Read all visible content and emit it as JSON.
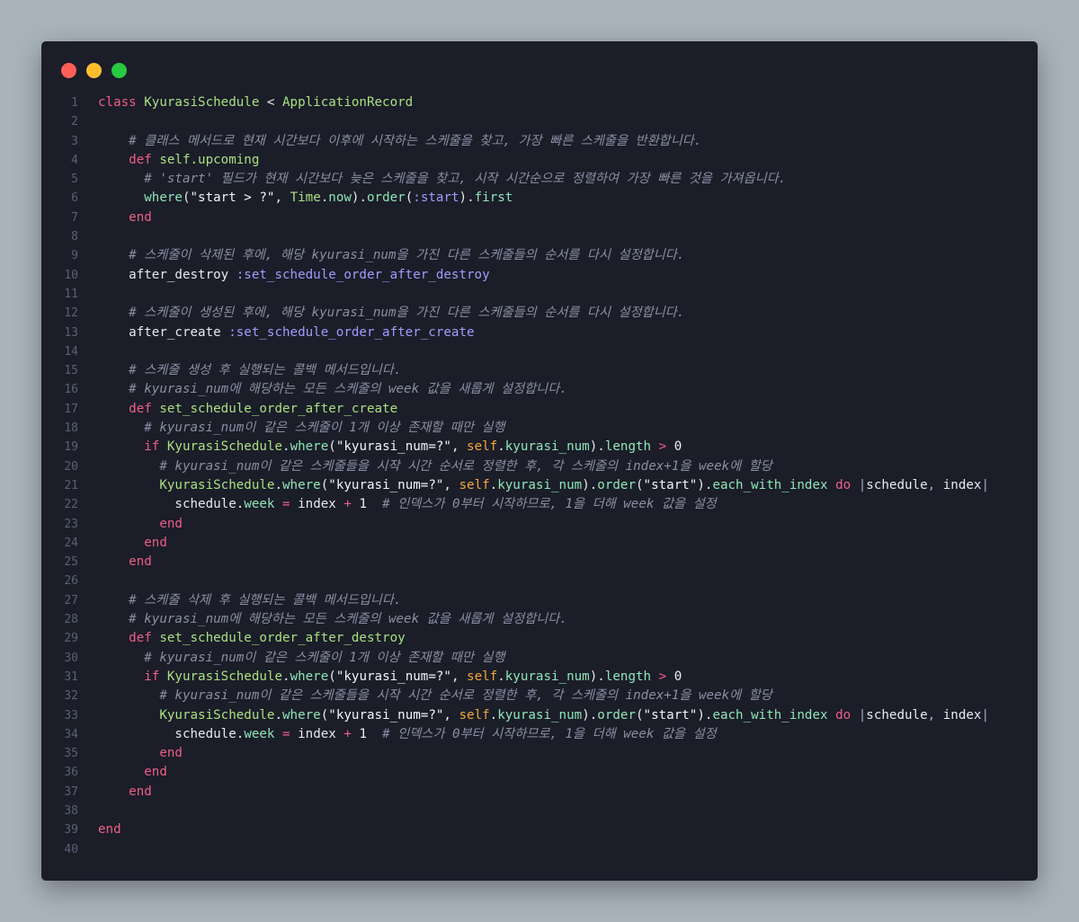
{
  "window": {
    "controls": [
      {
        "name": "close-button",
        "color": "#ff5f56"
      },
      {
        "name": "minimize-button",
        "color": "#ffbd2e"
      },
      {
        "name": "maximize-button",
        "color": "#27c93f"
      }
    ]
  },
  "code": {
    "lines": [
      {
        "n": "1",
        "tokens": [
          [
            "class",
            "kw"
          ],
          [
            " ",
            "pl"
          ],
          [
            "KyurasiSchedule",
            "cls"
          ],
          [
            " < ",
            "pl"
          ],
          [
            "ApplicationRecord",
            "cls"
          ]
        ]
      },
      {
        "n": "2",
        "tokens": []
      },
      {
        "n": "3",
        "tokens": [
          [
            "    ",
            "pl"
          ],
          [
            "# 클래스 메서드로 현재 시간보다 이후에 시작하는 스케줄을 찾고, 가장 빠른 스케줄을 반환합니다.",
            "cm"
          ]
        ]
      },
      {
        "n": "4",
        "tokens": [
          [
            "    ",
            "pl"
          ],
          [
            "def",
            "kw"
          ],
          [
            " ",
            "pl"
          ],
          [
            "self.upcoming",
            "def"
          ]
        ]
      },
      {
        "n": "5",
        "tokens": [
          [
            "      ",
            "pl"
          ],
          [
            "# 'start' 필드가 현재 시간보다 늦은 스케줄을 찾고, 시작 시간순으로 정렬하여 가장 빠른 것을 가져옵니다.",
            "cm"
          ]
        ]
      },
      {
        "n": "6",
        "tokens": [
          [
            "      ",
            "pl"
          ],
          [
            "where",
            "fn"
          ],
          [
            "(",
            "pl"
          ],
          [
            "\"start > ?\"",
            "str"
          ],
          [
            ", ",
            "pl"
          ],
          [
            "Time",
            "cls"
          ],
          [
            ".",
            "pl"
          ],
          [
            "now",
            "fn"
          ],
          [
            ").",
            "pl"
          ],
          [
            "order",
            "fn"
          ],
          [
            "(",
            "pl"
          ],
          [
            ":start",
            "sym"
          ],
          [
            ").",
            "pl"
          ],
          [
            "first",
            "fn"
          ]
        ]
      },
      {
        "n": "7",
        "tokens": [
          [
            "    ",
            "pl"
          ],
          [
            "end",
            "kw"
          ]
        ]
      },
      {
        "n": "8",
        "tokens": []
      },
      {
        "n": "9",
        "tokens": [
          [
            "    ",
            "pl"
          ],
          [
            "# 스케줄이 삭제된 후에, 해당 kyurasi_num을 가진 다른 스케줄들의 순서를 다시 설정합니다.",
            "cm"
          ]
        ]
      },
      {
        "n": "10",
        "tokens": [
          [
            "    ",
            "pl"
          ],
          [
            "after_destroy",
            "pl"
          ],
          [
            " ",
            "pl"
          ],
          [
            ":set_schedule_order_after_destroy",
            "sym"
          ]
        ]
      },
      {
        "n": "11",
        "tokens": []
      },
      {
        "n": "12",
        "tokens": [
          [
            "    ",
            "pl"
          ],
          [
            "# 스케줄이 생성된 후에, 해당 kyurasi_num을 가진 다른 스케줄들의 순서를 다시 설정합니다.",
            "cm"
          ]
        ]
      },
      {
        "n": "13",
        "tokens": [
          [
            "    ",
            "pl"
          ],
          [
            "after_create",
            "pl"
          ],
          [
            " ",
            "pl"
          ],
          [
            ":set_schedule_order_after_create",
            "sym"
          ]
        ]
      },
      {
        "n": "14",
        "tokens": []
      },
      {
        "n": "15",
        "tokens": [
          [
            "    ",
            "pl"
          ],
          [
            "# 스케줄 생성 후 실행되는 콜백 메서드입니다.",
            "cm"
          ]
        ]
      },
      {
        "n": "16",
        "tokens": [
          [
            "    ",
            "pl"
          ],
          [
            "# kyurasi_num에 해당하는 모든 스케줄의 week 값을 새롭게 설정합니다.",
            "cm"
          ]
        ]
      },
      {
        "n": "17",
        "tokens": [
          [
            "    ",
            "pl"
          ],
          [
            "def",
            "kw"
          ],
          [
            " ",
            "pl"
          ],
          [
            "set_schedule_order_after_create",
            "def"
          ]
        ]
      },
      {
        "n": "18",
        "tokens": [
          [
            "      ",
            "pl"
          ],
          [
            "# kyurasi_num이 같은 스케줄이 1개 이상 존재할 때만 실행",
            "cm"
          ]
        ]
      },
      {
        "n": "19",
        "tokens": [
          [
            "      ",
            "pl"
          ],
          [
            "if",
            "kw"
          ],
          [
            " ",
            "pl"
          ],
          [
            "KyurasiSchedule",
            "cls"
          ],
          [
            ".",
            "pl"
          ],
          [
            "where",
            "fn"
          ],
          [
            "(",
            "pl"
          ],
          [
            "\"kyurasi_num=?\"",
            "str"
          ],
          [
            ", ",
            "pl"
          ],
          [
            "self",
            "self"
          ],
          [
            ".",
            "pl"
          ],
          [
            "kyurasi_num",
            "fn"
          ],
          [
            ").",
            "pl"
          ],
          [
            "length",
            "fn"
          ],
          [
            " ",
            "pl"
          ],
          [
            ">",
            "op"
          ],
          [
            " ",
            "pl"
          ],
          [
            "0",
            "num"
          ]
        ]
      },
      {
        "n": "20",
        "tokens": [
          [
            "        ",
            "pl"
          ],
          [
            "# kyurasi_num이 같은 스케줄들을 시작 시간 순서로 정렬한 후, 각 스케줄의 index+1을 week에 할당",
            "cm"
          ]
        ]
      },
      {
        "n": "21",
        "tokens": [
          [
            "        ",
            "pl"
          ],
          [
            "KyurasiSchedule",
            "cls"
          ],
          [
            ".",
            "pl"
          ],
          [
            "where",
            "fn"
          ],
          [
            "(",
            "pl"
          ],
          [
            "\"kyurasi_num=?\"",
            "str"
          ],
          [
            ", ",
            "pl"
          ],
          [
            "self",
            "self"
          ],
          [
            ".",
            "pl"
          ],
          [
            "kyurasi_num",
            "fn"
          ],
          [
            ").",
            "pl"
          ],
          [
            "order",
            "fn"
          ],
          [
            "(",
            "pl"
          ],
          [
            "\"start\"",
            "str"
          ],
          [
            ").",
            "pl"
          ],
          [
            "each_with_index",
            "fn"
          ],
          [
            " ",
            "pl"
          ],
          [
            "do",
            "kw"
          ],
          [
            " ",
            "pl"
          ],
          [
            "|",
            "pn"
          ],
          [
            "schedule",
            "pl"
          ],
          [
            ", ",
            "pn"
          ],
          [
            "index",
            "pl"
          ],
          [
            "|",
            "pn"
          ]
        ]
      },
      {
        "n": "22",
        "tokens": [
          [
            "          ",
            "pl"
          ],
          [
            "schedule",
            "pl"
          ],
          [
            ".",
            "pl"
          ],
          [
            "week",
            "fn"
          ],
          [
            " ",
            "pl"
          ],
          [
            "=",
            "op"
          ],
          [
            " index ",
            "pl"
          ],
          [
            "+",
            "op"
          ],
          [
            " ",
            "pl"
          ],
          [
            "1",
            "num"
          ],
          [
            "  ",
            "pl"
          ],
          [
            "# 인덱스가 0부터 시작하므로, 1을 더해 week 값을 설정",
            "cm"
          ]
        ]
      },
      {
        "n": "23",
        "tokens": [
          [
            "        ",
            "pl"
          ],
          [
            "end",
            "kw"
          ]
        ]
      },
      {
        "n": "24",
        "tokens": [
          [
            "      ",
            "pl"
          ],
          [
            "end",
            "kw"
          ]
        ]
      },
      {
        "n": "25",
        "tokens": [
          [
            "    ",
            "pl"
          ],
          [
            "end",
            "kw"
          ]
        ]
      },
      {
        "n": "26",
        "tokens": []
      },
      {
        "n": "27",
        "tokens": [
          [
            "    ",
            "pl"
          ],
          [
            "# 스케줄 삭제 후 실행되는 콜백 메서드입니다.",
            "cm"
          ]
        ]
      },
      {
        "n": "28",
        "tokens": [
          [
            "    ",
            "pl"
          ],
          [
            "# kyurasi_num에 해당하는 모든 스케줄의 week 값을 새롭게 설정합니다.",
            "cm"
          ]
        ]
      },
      {
        "n": "29",
        "tokens": [
          [
            "    ",
            "pl"
          ],
          [
            "def",
            "kw"
          ],
          [
            " ",
            "pl"
          ],
          [
            "set_schedule_order_after_destroy",
            "def"
          ]
        ]
      },
      {
        "n": "30",
        "tokens": [
          [
            "      ",
            "pl"
          ],
          [
            "# kyurasi_num이 같은 스케줄이 1개 이상 존재할 때만 실행",
            "cm"
          ]
        ]
      },
      {
        "n": "31",
        "tokens": [
          [
            "      ",
            "pl"
          ],
          [
            "if",
            "kw"
          ],
          [
            " ",
            "pl"
          ],
          [
            "KyurasiSchedule",
            "cls"
          ],
          [
            ".",
            "pl"
          ],
          [
            "where",
            "fn"
          ],
          [
            "(",
            "pl"
          ],
          [
            "\"kyurasi_num=?\"",
            "str"
          ],
          [
            ", ",
            "pl"
          ],
          [
            "self",
            "self"
          ],
          [
            ".",
            "pl"
          ],
          [
            "kyurasi_num",
            "fn"
          ],
          [
            ").",
            "pl"
          ],
          [
            "length",
            "fn"
          ],
          [
            " ",
            "pl"
          ],
          [
            ">",
            "op"
          ],
          [
            " ",
            "pl"
          ],
          [
            "0",
            "num"
          ]
        ]
      },
      {
        "n": "32",
        "tokens": [
          [
            "        ",
            "pl"
          ],
          [
            "# kyurasi_num이 같은 스케줄들을 시작 시간 순서로 정렬한 후, 각 스케줄의 index+1을 week에 할당",
            "cm"
          ]
        ]
      },
      {
        "n": "33",
        "tokens": [
          [
            "        ",
            "pl"
          ],
          [
            "KyurasiSchedule",
            "cls"
          ],
          [
            ".",
            "pl"
          ],
          [
            "where",
            "fn"
          ],
          [
            "(",
            "pl"
          ],
          [
            "\"kyurasi_num=?\"",
            "str"
          ],
          [
            ", ",
            "pl"
          ],
          [
            "self",
            "self"
          ],
          [
            ".",
            "pl"
          ],
          [
            "kyurasi_num",
            "fn"
          ],
          [
            ").",
            "pl"
          ],
          [
            "order",
            "fn"
          ],
          [
            "(",
            "pl"
          ],
          [
            "\"start\"",
            "str"
          ],
          [
            ").",
            "pl"
          ],
          [
            "each_with_index",
            "fn"
          ],
          [
            " ",
            "pl"
          ],
          [
            "do",
            "kw"
          ],
          [
            " ",
            "pl"
          ],
          [
            "|",
            "pn"
          ],
          [
            "schedule",
            "pl"
          ],
          [
            ", ",
            "pn"
          ],
          [
            "index",
            "pl"
          ],
          [
            "|",
            "pn"
          ]
        ]
      },
      {
        "n": "34",
        "tokens": [
          [
            "          ",
            "pl"
          ],
          [
            "schedule",
            "pl"
          ],
          [
            ".",
            "pl"
          ],
          [
            "week",
            "fn"
          ],
          [
            " ",
            "pl"
          ],
          [
            "=",
            "op"
          ],
          [
            " index ",
            "pl"
          ],
          [
            "+",
            "op"
          ],
          [
            " ",
            "pl"
          ],
          [
            "1",
            "num"
          ],
          [
            "  ",
            "pl"
          ],
          [
            "# 인덱스가 0부터 시작하므로, 1을 더해 week 값을 설정",
            "cm"
          ]
        ]
      },
      {
        "n": "35",
        "tokens": [
          [
            "        ",
            "pl"
          ],
          [
            "end",
            "kw"
          ]
        ]
      },
      {
        "n": "36",
        "tokens": [
          [
            "      ",
            "pl"
          ],
          [
            "end",
            "kw"
          ]
        ]
      },
      {
        "n": "37",
        "tokens": [
          [
            "    ",
            "pl"
          ],
          [
            "end",
            "kw"
          ]
        ]
      },
      {
        "n": "38",
        "tokens": []
      },
      {
        "n": "39",
        "tokens": [
          [
            "end",
            "kw"
          ]
        ]
      },
      {
        "n": "40",
        "tokens": []
      }
    ]
  }
}
